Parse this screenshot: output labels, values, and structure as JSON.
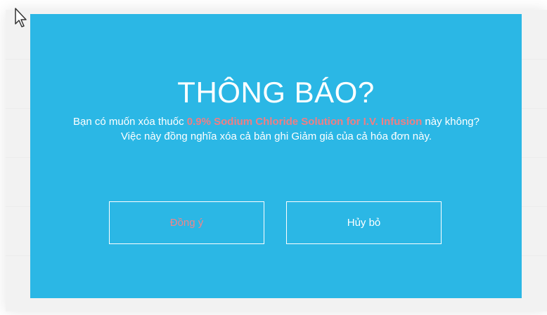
{
  "dialog": {
    "title": "THÔNG BÁO?",
    "message_prefix": "Bạn có muốn xóa thuốc ",
    "drug_name": "0.9% Sodium Chloride Solution for I.V. Infusion",
    "message_suffix": " này không?",
    "message_line2": "Việc này đồng nghĩa xóa cả bản ghi Giảm giá của cả hóa đơn này.",
    "confirm_label": "Đồng ý",
    "cancel_label": "Hủy bỏ"
  },
  "colors": {
    "dialog_background": "#2bb7e5",
    "drug_highlight": "#f07e84",
    "text": "#ffffff"
  },
  "icons": {
    "cursor": "mouse-pointer-icon"
  }
}
